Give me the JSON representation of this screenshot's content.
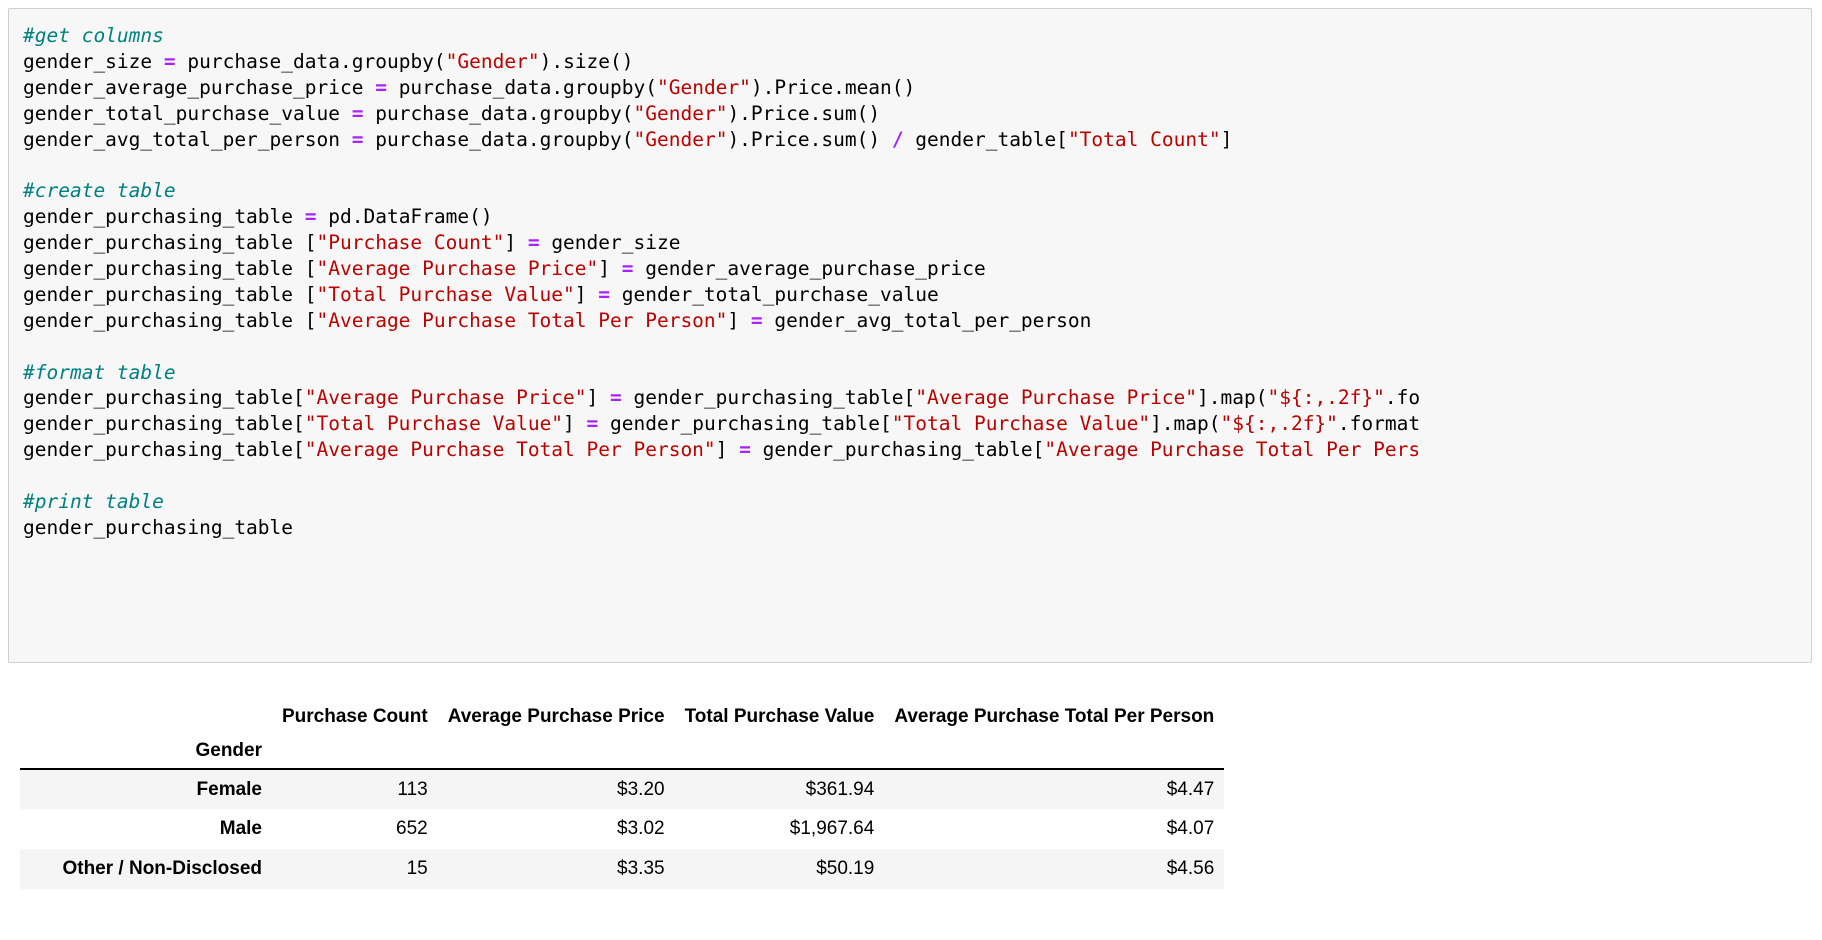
{
  "code_cell": {
    "language": "python",
    "lines": [
      {
        "type": "comment",
        "text": "#get columns"
      },
      {
        "type": "code",
        "segments": [
          {
            "t": "gender_size ",
            "c": "plain"
          },
          {
            "t": "=",
            "c": "op"
          },
          {
            "t": " purchase_data.groupby(",
            "c": "plain"
          },
          {
            "t": "\"Gender\"",
            "c": "string"
          },
          {
            "t": ").size()",
            "c": "plain"
          }
        ]
      },
      {
        "type": "code",
        "segments": [
          {
            "t": "gender_average_purchase_price ",
            "c": "plain"
          },
          {
            "t": "=",
            "c": "op"
          },
          {
            "t": " purchase_data.groupby(",
            "c": "plain"
          },
          {
            "t": "\"Gender\"",
            "c": "string"
          },
          {
            "t": ").Price.mean()",
            "c": "plain"
          }
        ]
      },
      {
        "type": "code",
        "segments": [
          {
            "t": "gender_total_purchase_value ",
            "c": "plain"
          },
          {
            "t": "=",
            "c": "op"
          },
          {
            "t": " purchase_data.groupby(",
            "c": "plain"
          },
          {
            "t": "\"Gender\"",
            "c": "string"
          },
          {
            "t": ").Price.sum()",
            "c": "plain"
          }
        ]
      },
      {
        "type": "code",
        "segments": [
          {
            "t": "gender_avg_total_per_person ",
            "c": "plain"
          },
          {
            "t": "=",
            "c": "op"
          },
          {
            "t": " purchase_data.groupby(",
            "c": "plain"
          },
          {
            "t": "\"Gender\"",
            "c": "string"
          },
          {
            "t": ").Price.sum() ",
            "c": "plain"
          },
          {
            "t": "/",
            "c": "op"
          },
          {
            "t": " gender_table[",
            "c": "plain"
          },
          {
            "t": "\"Total Count\"",
            "c": "string"
          },
          {
            "t": "]",
            "c": "plain"
          }
        ]
      },
      {
        "type": "blank"
      },
      {
        "type": "comment",
        "text": "#create table"
      },
      {
        "type": "code",
        "segments": [
          {
            "t": "gender_purchasing_table ",
            "c": "plain"
          },
          {
            "t": "=",
            "c": "op"
          },
          {
            "t": " pd.DataFrame()",
            "c": "plain"
          }
        ]
      },
      {
        "type": "code",
        "segments": [
          {
            "t": "gender_purchasing_table [",
            "c": "plain"
          },
          {
            "t": "\"Purchase Count\"",
            "c": "string"
          },
          {
            "t": "] ",
            "c": "plain"
          },
          {
            "t": "=",
            "c": "op"
          },
          {
            "t": " gender_size",
            "c": "plain"
          }
        ]
      },
      {
        "type": "code",
        "segments": [
          {
            "t": "gender_purchasing_table [",
            "c": "plain"
          },
          {
            "t": "\"Average Purchase Price\"",
            "c": "string"
          },
          {
            "t": "] ",
            "c": "plain"
          },
          {
            "t": "=",
            "c": "op"
          },
          {
            "t": " gender_average_purchase_price",
            "c": "plain"
          }
        ]
      },
      {
        "type": "code",
        "segments": [
          {
            "t": "gender_purchasing_table [",
            "c": "plain"
          },
          {
            "t": "\"Total Purchase Value\"",
            "c": "string"
          },
          {
            "t": "] ",
            "c": "plain"
          },
          {
            "t": "=",
            "c": "op"
          },
          {
            "t": " gender_total_purchase_value",
            "c": "plain"
          }
        ]
      },
      {
        "type": "code",
        "segments": [
          {
            "t": "gender_purchasing_table [",
            "c": "plain"
          },
          {
            "t": "\"Average Purchase Total Per Person\"",
            "c": "string"
          },
          {
            "t": "] ",
            "c": "plain"
          },
          {
            "t": "=",
            "c": "op"
          },
          {
            "t": " gender_avg_total_per_person",
            "c": "plain"
          }
        ]
      },
      {
        "type": "blank"
      },
      {
        "type": "comment",
        "text": "#format table"
      },
      {
        "type": "code",
        "segments": [
          {
            "t": "gender_purchasing_table[",
            "c": "plain"
          },
          {
            "t": "\"Average Purchase Price\"",
            "c": "string"
          },
          {
            "t": "] ",
            "c": "plain"
          },
          {
            "t": "=",
            "c": "op"
          },
          {
            "t": " gender_purchasing_table[",
            "c": "plain"
          },
          {
            "t": "\"Average Purchase Price\"",
            "c": "string"
          },
          {
            "t": "].map(",
            "c": "plain"
          },
          {
            "t": "\"${:,.2f}\"",
            "c": "string"
          },
          {
            "t": ".fo",
            "c": "plain"
          }
        ]
      },
      {
        "type": "code",
        "segments": [
          {
            "t": "gender_purchasing_table[",
            "c": "plain"
          },
          {
            "t": "\"Total Purchase Value\"",
            "c": "string"
          },
          {
            "t": "] ",
            "c": "plain"
          },
          {
            "t": "=",
            "c": "op"
          },
          {
            "t": " gender_purchasing_table[",
            "c": "plain"
          },
          {
            "t": "\"Total Purchase Value\"",
            "c": "string"
          },
          {
            "t": "].map(",
            "c": "plain"
          },
          {
            "t": "\"${:,.2f}\"",
            "c": "string"
          },
          {
            "t": ".format",
            "c": "plain"
          }
        ]
      },
      {
        "type": "code",
        "segments": [
          {
            "t": "gender_purchasing_table[",
            "c": "plain"
          },
          {
            "t": "\"Average Purchase Total Per Person\"",
            "c": "string"
          },
          {
            "t": "] ",
            "c": "plain"
          },
          {
            "t": "=",
            "c": "op"
          },
          {
            "t": " gender_purchasing_table[",
            "c": "plain"
          },
          {
            "t": "\"Average Purchase Total Per Pers",
            "c": "string"
          }
        ]
      },
      {
        "type": "blank"
      },
      {
        "type": "comment",
        "text": "#print table"
      },
      {
        "type": "code",
        "segments": [
          {
            "t": "gender_purchasing_table",
            "c": "plain"
          }
        ]
      }
    ],
    "colors": {
      "background": "#f7f7f7",
      "border": "#cfcfcf",
      "text": "#000000",
      "comment": "#008080",
      "string": "#bb0000",
      "operator": "#aa22ff"
    }
  },
  "output": {
    "index_name": "Gender",
    "columns": [
      "Purchase Count",
      "Average Purchase Price",
      "Total Purchase Value",
      "Average Purchase Total Per Person"
    ],
    "rows": [
      {
        "index": "Female",
        "cells": [
          "113",
          "$3.20",
          "$361.94",
          "$4.47"
        ]
      },
      {
        "index": "Male",
        "cells": [
          "652",
          "$3.02",
          "$1,967.64",
          "$4.07"
        ]
      },
      {
        "index": "Other / Non-Disclosed",
        "cells": [
          "15",
          "$3.35",
          "$50.19",
          "$4.56"
        ]
      }
    ],
    "colors": {
      "stripe": "#f5f5f5",
      "rule": "#000000",
      "text": "#000000"
    }
  }
}
